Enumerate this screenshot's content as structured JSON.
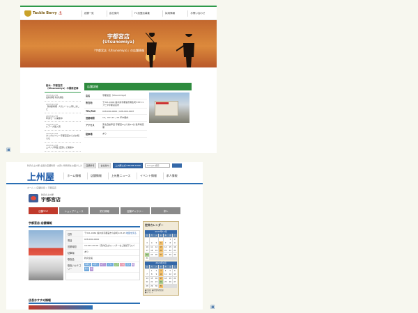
{
  "shot1": {
    "logo_text": "Tackle Berry",
    "nav": [
      "店舗一覧",
      "会社案内",
      "FC加盟店募集",
      "採用情報",
      "お問い合わせ"
    ],
    "hero": {
      "title": "宇都宮店",
      "title_roman": "(Utsunomiya)",
      "subtitle": "『宇都宮店（Utsunomiya）』の店舗情報"
    },
    "sidebar": {
      "heading": "栃木・宇都宮店（Utsunomiya）の最新記事",
      "items": [
        {
          "date": "2023/12/26",
          "text": "最新買取 釣具多数"
        },
        {
          "date": "2023/12/20",
          "text": "【新着情報】人気リール入荷しました"
        },
        {
          "date": "2023/12/15",
          "text": "年末セール開催中"
        },
        {
          "date": "2023/12/10",
          "text": "ルアー大量入荷"
        },
        {
          "date": "2023/12/05",
          "text": "タックルベリー宇都宮店からのお知らせ"
        },
        {
          "date": "2023/11/28",
          "text": "エギング特集 店頭にて開催中"
        }
      ]
    },
    "main": {
      "header": "店舗詳細",
      "rows": [
        {
          "label": "店名",
          "value": "宇都宮店（Utsunomiya）"
        },
        {
          "label": "所在地",
          "value": "〒321-0000 栃木県宇都宮市駒生町3337-1 アピタ宇都宮店内"
        },
        {
          "label": "TEL/FAX",
          "value": "028-000-0000 / 028-000-0007"
        },
        {
          "label": "営業時間",
          "value": "10：00～21：00 年中無休"
        },
        {
          "label": "アクセス",
          "value": "東北自動車道 宇都宮ICより約10分 駐車場完備"
        },
        {
          "label": "駐車場",
          "value": "あり"
        }
      ]
    }
  },
  "shot2": {
    "topbar_text": "釣具の上州屋 全国の店舗情報・お買い得情報をお届けします",
    "top_buttons": [
      "店舗情報",
      "会社案内",
      "上州屋公式 ONLINE SHOP"
    ],
    "search_placeholder": "Google 検索",
    "logo": "上州屋",
    "nav": [
      "ホーム情報",
      "店舗情報",
      "上州屋ニュース",
      "イベント情報",
      "求人情報"
    ],
    "breadcrumb": "ホーム > 店舗情報 > 宇都宮店",
    "store_sub": "釣具の上州屋",
    "store_name": "宇都宮店",
    "tabs": [
      "店舗TOP",
      "ショップニュース",
      "釣行情報",
      "店舗ギャラリー",
      "求人"
    ],
    "section_title": "宇都宮店-店舗情報",
    "rows": [
      {
        "label": "住所",
        "value": "〒321-0962 栃木県宇都宮市今泉町123-45",
        "link": "地図を見る"
      },
      {
        "label": "電話",
        "value": "028-000-0000"
      },
      {
        "label": "営業時間",
        "value": "10:00～20:00（定休日はカレンダーをご確認下さい）"
      },
      {
        "label": "駐車場",
        "value": "あり"
      },
      {
        "label": "取扱品",
        "value": "釣具全般"
      }
    ],
    "tags_label": "取扱いカテゴリー",
    "tags": [
      "海釣り",
      "川釣り",
      "ルアー",
      "フライ",
      "エサ",
      "バス",
      "渓流",
      "磯",
      "投げ",
      "船"
    ],
    "calendar": {
      "title": "定休カレンダー",
      "months": [
        "2023年12月",
        "2024年1月"
      ],
      "weekdays": [
        "日",
        "月",
        "火",
        "水",
        "木",
        "金",
        "土"
      ],
      "legend": [
        "■定休日",
        "■営業時間変更",
        "■イベント"
      ]
    },
    "recommend_title": "店長おすすめ情報"
  }
}
